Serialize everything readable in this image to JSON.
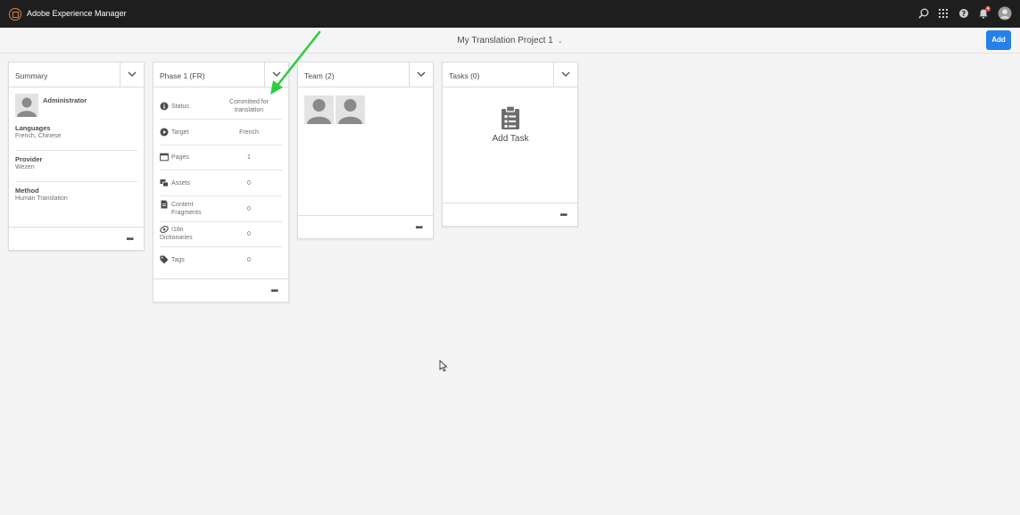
{
  "topbar": {
    "app_title": "Adobe Experience Manager",
    "icons": [
      "search-icon",
      "apps-grid-icon",
      "help-icon",
      "notification-bell-icon",
      "user-avatar"
    ],
    "notification_count": "4"
  },
  "header": {
    "project_title": "My Translation Project 1",
    "add_label": "Add",
    "accent_color": "#2680eb"
  },
  "summary": {
    "title": "Summary",
    "user_name": "Administrator",
    "fields": [
      {
        "label": "Languages",
        "value": "French, Chinese"
      },
      {
        "label": "Provider",
        "value": "Wezen"
      },
      {
        "label": "Method",
        "value": "Human Translation"
      }
    ]
  },
  "phase": {
    "title": "Phase 1 (FR)",
    "rows": [
      {
        "icon": "info-icon",
        "label": "Status",
        "value": "Committed for translation"
      },
      {
        "icon": "play-circle-icon",
        "label": "Target",
        "value": "French"
      },
      {
        "icon": "pages-icon",
        "label": "Pages",
        "value": "1"
      },
      {
        "icon": "assets-icon",
        "label": "Assets",
        "value": "0"
      },
      {
        "icon": "document-icon",
        "label": "Content Fragments",
        "value": "0"
      },
      {
        "icon": "dictionary-icon",
        "label": "I18n Dictionaries",
        "value": "0"
      },
      {
        "icon": "tag-icon",
        "label": "Tags",
        "value": "0"
      }
    ]
  },
  "team": {
    "title": "Team (2)",
    "members": 2
  },
  "tasks": {
    "title": "Tasks (0)",
    "add_task_label": "Add Task"
  },
  "annotation": {
    "arrow_color": "#2ecc40"
  }
}
